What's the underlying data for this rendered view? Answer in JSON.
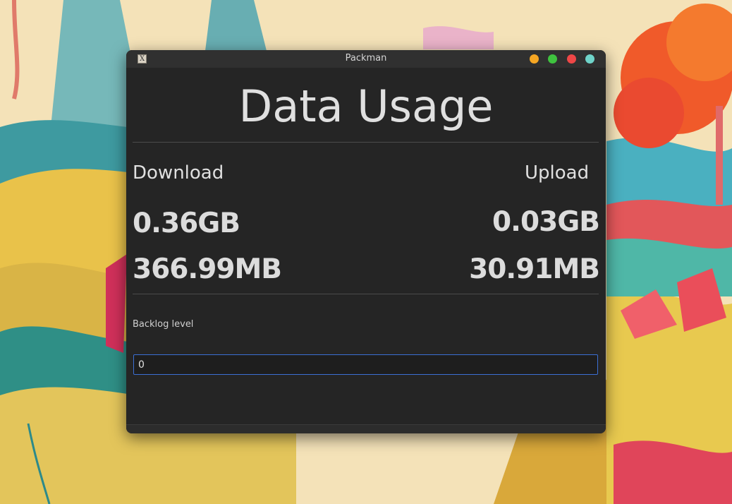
{
  "window": {
    "title": "Packman",
    "app_icon": "packman-app-icon",
    "controls": [
      "minimize-button",
      "maximize-button",
      "close-button",
      "pin-button"
    ],
    "colors": {
      "minimize": "#f5a623",
      "maximize": "#3fc33f",
      "close": "#ef4747",
      "pin": "#6fd3c9"
    }
  },
  "main": {
    "heading": "Data Usage",
    "download": {
      "label": "Download",
      "gb": "0.36GB",
      "mb": "366.99MB"
    },
    "upload": {
      "label": "Upload",
      "gb": "0.03GB",
      "mb": "30.91MB"
    },
    "backlog": {
      "label": "Backlog level",
      "value": "0"
    }
  }
}
